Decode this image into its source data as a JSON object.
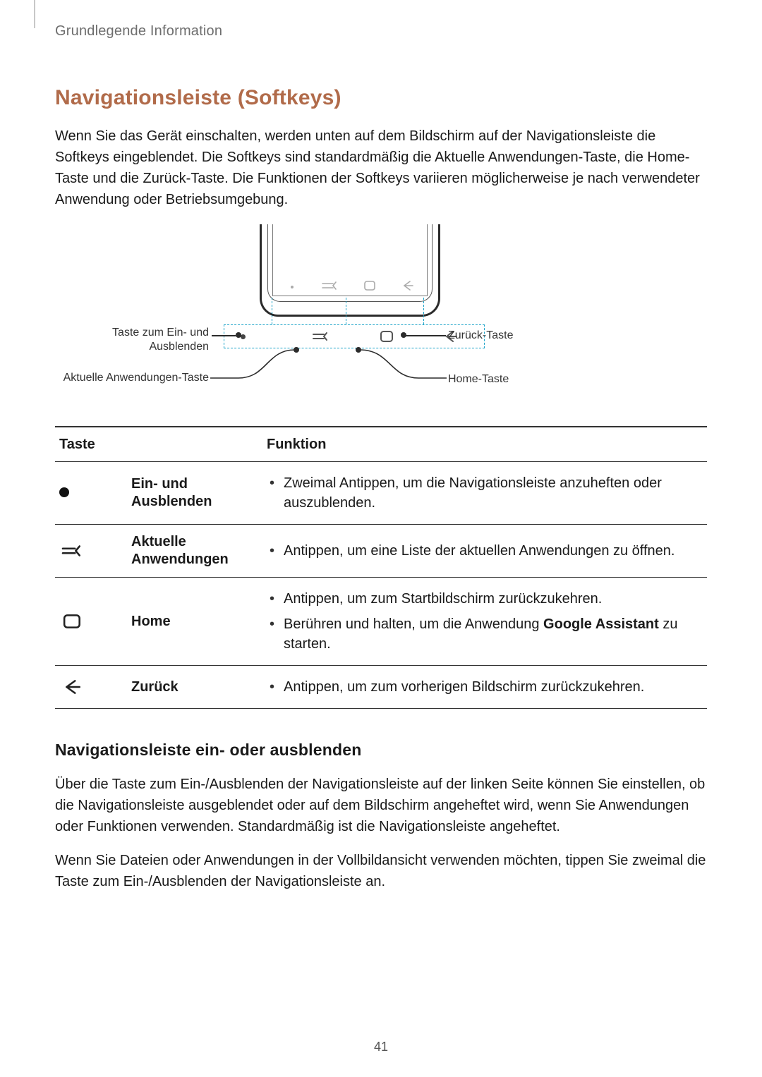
{
  "breadcrumb": "Grundlegende Information",
  "section_title": "Navigationsleiste (Softkeys)",
  "intro": "Wenn Sie das Gerät einschalten, werden unten auf dem Bildschirm auf der Navigationsleiste die Softkeys eingeblendet. Die Softkeys sind standardmäßig die Aktuelle Anwendungen-Taste, die Home-Taste und die Zurück-Taste. Die Funktionen der Softkeys variieren möglicherweise je nach verwendeter Anwendung oder Betriebsumgebung.",
  "diagram": {
    "left_top": "Taste zum Ein- und Ausblenden",
    "left_bottom": "Aktuelle Anwendungen-Taste",
    "right_top": "Zurück-Taste",
    "right_bottom": "Home-Taste"
  },
  "table": {
    "head_key": "Taste",
    "head_func": "Funktion",
    "rows": [
      {
        "icon": "dot",
        "name": "Ein- und Ausblenden",
        "funcs": [
          "Zweimal Antippen, um die Navigationsleiste anzuheften oder auszublenden."
        ]
      },
      {
        "icon": "recents",
        "name": "Aktuelle Anwendungen",
        "funcs": [
          "Antippen, um eine Liste der aktuellen Anwendungen zu öffnen."
        ]
      },
      {
        "icon": "home",
        "name": "Home",
        "funcs": [
          "Antippen, um zum Startbildschirm zurückzukehren.",
          "Berühren und halten, um die Anwendung <b>Google Assistant</b> zu starten."
        ]
      },
      {
        "icon": "back",
        "name": "Zurück",
        "funcs": [
          "Antippen, um zum vorherigen Bildschirm zurückzukehren."
        ]
      }
    ]
  },
  "sub_heading": "Navigationsleiste ein- oder ausblenden",
  "para2": "Über die Taste zum Ein-/Ausblenden der Navigationsleiste auf der linken Seite können Sie einstellen, ob die Navigationsleiste ausgeblendet oder auf dem Bildschirm angeheftet wird, wenn Sie Anwendungen oder Funktionen verwenden. Standardmäßig ist die Navigationsleiste angeheftet.",
  "para3": "Wenn Sie Dateien oder Anwendungen in der Vollbildansicht verwenden möchten, tippen Sie zweimal die Taste zum Ein-/Ausblenden der Navigationsleiste an.",
  "page_number": "41"
}
